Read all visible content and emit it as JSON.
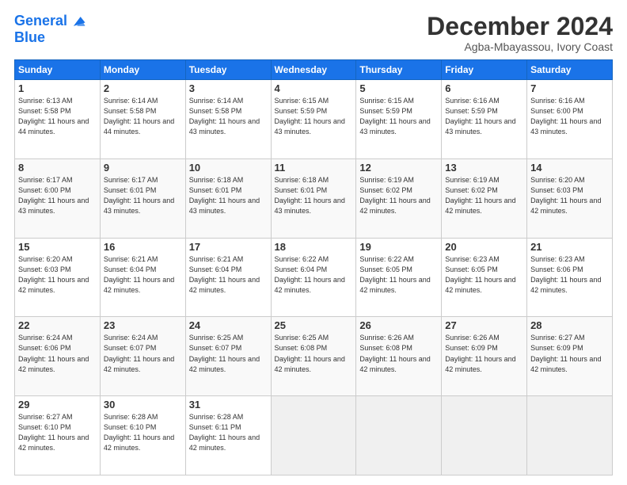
{
  "logo": {
    "line1": "General",
    "line2": "Blue"
  },
  "title": "December 2024",
  "location": "Agba-Mbayassou, Ivory Coast",
  "weekdays": [
    "Sunday",
    "Monday",
    "Tuesday",
    "Wednesday",
    "Thursday",
    "Friday",
    "Saturday"
  ],
  "rows": [
    [
      {
        "day": "1",
        "sunrise": "6:13 AM",
        "sunset": "5:58 PM",
        "daylight": "11 hours and 44 minutes."
      },
      {
        "day": "2",
        "sunrise": "6:14 AM",
        "sunset": "5:58 PM",
        "daylight": "11 hours and 44 minutes."
      },
      {
        "day": "3",
        "sunrise": "6:14 AM",
        "sunset": "5:58 PM",
        "daylight": "11 hours and 43 minutes."
      },
      {
        "day": "4",
        "sunrise": "6:15 AM",
        "sunset": "5:59 PM",
        "daylight": "11 hours and 43 minutes."
      },
      {
        "day": "5",
        "sunrise": "6:15 AM",
        "sunset": "5:59 PM",
        "daylight": "11 hours and 43 minutes."
      },
      {
        "day": "6",
        "sunrise": "6:16 AM",
        "sunset": "5:59 PM",
        "daylight": "11 hours and 43 minutes."
      },
      {
        "day": "7",
        "sunrise": "6:16 AM",
        "sunset": "6:00 PM",
        "daylight": "11 hours and 43 minutes."
      }
    ],
    [
      {
        "day": "8",
        "sunrise": "6:17 AM",
        "sunset": "6:00 PM",
        "daylight": "11 hours and 43 minutes."
      },
      {
        "day": "9",
        "sunrise": "6:17 AM",
        "sunset": "6:01 PM",
        "daylight": "11 hours and 43 minutes."
      },
      {
        "day": "10",
        "sunrise": "6:18 AM",
        "sunset": "6:01 PM",
        "daylight": "11 hours and 43 minutes."
      },
      {
        "day": "11",
        "sunrise": "6:18 AM",
        "sunset": "6:01 PM",
        "daylight": "11 hours and 43 minutes."
      },
      {
        "day": "12",
        "sunrise": "6:19 AM",
        "sunset": "6:02 PM",
        "daylight": "11 hours and 42 minutes."
      },
      {
        "day": "13",
        "sunrise": "6:19 AM",
        "sunset": "6:02 PM",
        "daylight": "11 hours and 42 minutes."
      },
      {
        "day": "14",
        "sunrise": "6:20 AM",
        "sunset": "6:03 PM",
        "daylight": "11 hours and 42 minutes."
      }
    ],
    [
      {
        "day": "15",
        "sunrise": "6:20 AM",
        "sunset": "6:03 PM",
        "daylight": "11 hours and 42 minutes."
      },
      {
        "day": "16",
        "sunrise": "6:21 AM",
        "sunset": "6:04 PM",
        "daylight": "11 hours and 42 minutes."
      },
      {
        "day": "17",
        "sunrise": "6:21 AM",
        "sunset": "6:04 PM",
        "daylight": "11 hours and 42 minutes."
      },
      {
        "day": "18",
        "sunrise": "6:22 AM",
        "sunset": "6:04 PM",
        "daylight": "11 hours and 42 minutes."
      },
      {
        "day": "19",
        "sunrise": "6:22 AM",
        "sunset": "6:05 PM",
        "daylight": "11 hours and 42 minutes."
      },
      {
        "day": "20",
        "sunrise": "6:23 AM",
        "sunset": "6:05 PM",
        "daylight": "11 hours and 42 minutes."
      },
      {
        "day": "21",
        "sunrise": "6:23 AM",
        "sunset": "6:06 PM",
        "daylight": "11 hours and 42 minutes."
      }
    ],
    [
      {
        "day": "22",
        "sunrise": "6:24 AM",
        "sunset": "6:06 PM",
        "daylight": "11 hours and 42 minutes."
      },
      {
        "day": "23",
        "sunrise": "6:24 AM",
        "sunset": "6:07 PM",
        "daylight": "11 hours and 42 minutes."
      },
      {
        "day": "24",
        "sunrise": "6:25 AM",
        "sunset": "6:07 PM",
        "daylight": "11 hours and 42 minutes."
      },
      {
        "day": "25",
        "sunrise": "6:25 AM",
        "sunset": "6:08 PM",
        "daylight": "11 hours and 42 minutes."
      },
      {
        "day": "26",
        "sunrise": "6:26 AM",
        "sunset": "6:08 PM",
        "daylight": "11 hours and 42 minutes."
      },
      {
        "day": "27",
        "sunrise": "6:26 AM",
        "sunset": "6:09 PM",
        "daylight": "11 hours and 42 minutes."
      },
      {
        "day": "28",
        "sunrise": "6:27 AM",
        "sunset": "6:09 PM",
        "daylight": "11 hours and 42 minutes."
      }
    ],
    [
      {
        "day": "29",
        "sunrise": "6:27 AM",
        "sunset": "6:10 PM",
        "daylight": "11 hours and 42 minutes."
      },
      {
        "day": "30",
        "sunrise": "6:28 AM",
        "sunset": "6:10 PM",
        "daylight": "11 hours and 42 minutes."
      },
      {
        "day": "31",
        "sunrise": "6:28 AM",
        "sunset": "6:11 PM",
        "daylight": "11 hours and 42 minutes."
      },
      null,
      null,
      null,
      null
    ]
  ]
}
